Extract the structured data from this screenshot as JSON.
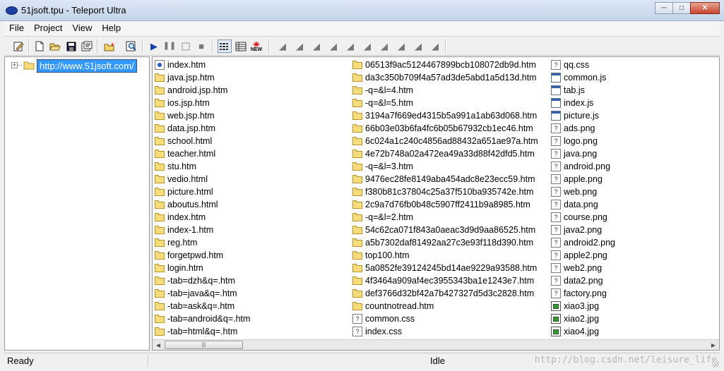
{
  "window": {
    "title": "51jsoft.tpu - Teleport Ultra"
  },
  "menu": [
    "File",
    "Project",
    "View",
    "Help"
  ],
  "tree": {
    "root_label": "http://www.51jsoft.com/"
  },
  "files": {
    "column1": [
      {
        "name": "index.htm",
        "icon": "htm"
      },
      {
        "name": "java.jsp.htm",
        "icon": "folder"
      },
      {
        "name": "android.jsp.htm",
        "icon": "folder"
      },
      {
        "name": "ios.jsp.htm",
        "icon": "folder"
      },
      {
        "name": "web.jsp.htm",
        "icon": "folder"
      },
      {
        "name": "data.jsp.htm",
        "icon": "folder"
      },
      {
        "name": "school.html",
        "icon": "folder"
      },
      {
        "name": "teacher.html",
        "icon": "folder"
      },
      {
        "name": "stu.htm",
        "icon": "folder"
      },
      {
        "name": "vedio.html",
        "icon": "folder"
      },
      {
        "name": "picture.html",
        "icon": "folder"
      },
      {
        "name": "aboutus.html",
        "icon": "folder"
      },
      {
        "name": "index.htm",
        "icon": "folder"
      },
      {
        "name": "index-1.htm",
        "icon": "folder"
      },
      {
        "name": "reg.htm",
        "icon": "folder"
      },
      {
        "name": "forgetpwd.htm",
        "icon": "folder"
      },
      {
        "name": "login.htm",
        "icon": "folder"
      },
      {
        "name": "-tab=dzh&q=.htm",
        "icon": "folder"
      },
      {
        "name": "-tab=java&q=.htm",
        "icon": "folder"
      },
      {
        "name": "-tab=ask&q=.htm",
        "icon": "folder"
      },
      {
        "name": "-tab=android&q=.htm",
        "icon": "folder"
      },
      {
        "name": "-tab=html&q=.htm",
        "icon": "folder"
      }
    ],
    "column2": [
      {
        "name": "06513f9ac5124467899bcb108072db9d.htm",
        "icon": "folder"
      },
      {
        "name": "da3c350b709f4a57ad3de5abd1a5d13d.htm",
        "icon": "folder"
      },
      {
        "name": "-q=&l=4.htm",
        "icon": "folder"
      },
      {
        "name": "-q=&l=5.htm",
        "icon": "folder"
      },
      {
        "name": "3194a7f669ed4315b5a991a1ab63d068.htm",
        "icon": "folder"
      },
      {
        "name": "66b03e03b6fa4fc6b05b67932cb1ec46.htm",
        "icon": "folder"
      },
      {
        "name": "6c024a1c240c4856ad88432a651ae97a.htm",
        "icon": "folder"
      },
      {
        "name": "4e72b748a02a472ea49a33d88f42dfd5.htm",
        "icon": "folder"
      },
      {
        "name": "-q=&l=3.htm",
        "icon": "folder"
      },
      {
        "name": "9476ec28fe8149aba454adc8e23ecc59.htm",
        "icon": "folder"
      },
      {
        "name": "f380b81c37804c25a37f510ba935742e.htm",
        "icon": "folder"
      },
      {
        "name": "2c9a7d76fb0b48c5907ff2411b9a8985.htm",
        "icon": "folder"
      },
      {
        "name": "-q=&l=2.htm",
        "icon": "folder"
      },
      {
        "name": "54c62ca071f843a0aeac3d9d9aa86525.htm",
        "icon": "folder"
      },
      {
        "name": "a5b7302daf81492aa27c3e93f118d390.htm",
        "icon": "folder"
      },
      {
        "name": "top100.htm",
        "icon": "folder"
      },
      {
        "name": "5a0852fe39124245bd14ae9229a93588.htm",
        "icon": "folder"
      },
      {
        "name": "4f3464a909af4ec3955343ba1e1243e7.htm",
        "icon": "folder"
      },
      {
        "name": "def3766d32bf42a7b427327d5d3c2828.htm",
        "icon": "folder"
      },
      {
        "name": "countnotread.htm",
        "icon": "folder"
      },
      {
        "name": "common.css",
        "icon": "unknown"
      },
      {
        "name": "index.css",
        "icon": "unknown"
      }
    ],
    "column3": [
      {
        "name": "qq.css",
        "icon": "unknown"
      },
      {
        "name": "common.js",
        "icon": "window"
      },
      {
        "name": "tab.js",
        "icon": "window"
      },
      {
        "name": "index.js",
        "icon": "window"
      },
      {
        "name": "picture.js",
        "icon": "window"
      },
      {
        "name": "ads.png",
        "icon": "unknown"
      },
      {
        "name": "logo.png",
        "icon": "unknown"
      },
      {
        "name": "java.png",
        "icon": "unknown"
      },
      {
        "name": "android.png",
        "icon": "unknown"
      },
      {
        "name": "apple.png",
        "icon": "unknown"
      },
      {
        "name": "web.png",
        "icon": "unknown"
      },
      {
        "name": "data.png",
        "icon": "unknown"
      },
      {
        "name": "course.png",
        "icon": "unknown"
      },
      {
        "name": "java2.png",
        "icon": "unknown"
      },
      {
        "name": "android2.png",
        "icon": "unknown"
      },
      {
        "name": "apple2.png",
        "icon": "unknown"
      },
      {
        "name": "web2.png",
        "icon": "unknown"
      },
      {
        "name": "data2.png",
        "icon": "unknown"
      },
      {
        "name": "factory.png",
        "icon": "unknown"
      },
      {
        "name": "xiao3.jpg",
        "icon": "image"
      },
      {
        "name": "xiao2.jpg",
        "icon": "image"
      },
      {
        "name": "xiao4.jpg",
        "icon": "image"
      }
    ]
  },
  "status": {
    "left": "Ready",
    "middle": "Idle",
    "watermark": "http://blog.csdn.net/leisure_life"
  },
  "toolbar_new_badge": "NEW"
}
